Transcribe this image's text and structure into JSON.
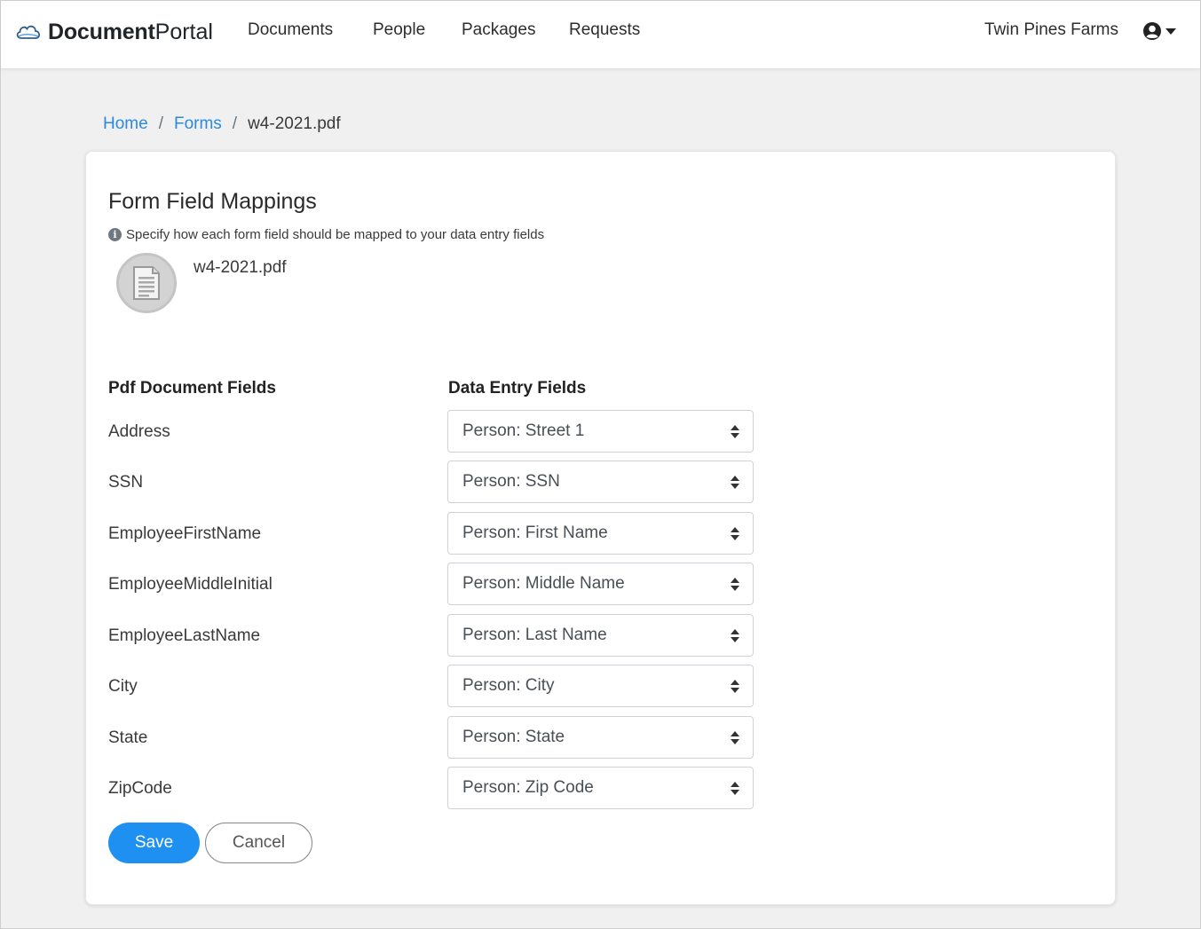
{
  "header": {
    "brand_bold": "Document",
    "brand_light": "Portal",
    "nav": [
      "Documents",
      "People",
      "Packages",
      "Requests"
    ],
    "organization": "Twin Pines Farms",
    "icons": {
      "brand": "cloud-icon",
      "user": "user-circle-icon"
    }
  },
  "breadcrumb": {
    "home": "Home",
    "forms": "Forms",
    "current": "w4-2021.pdf"
  },
  "card": {
    "title": "Form Field Mappings",
    "hint": "Specify how each form field should be mapped to your data entry fields",
    "file_name": "w4-2021.pdf",
    "col_pdf": "Pdf Document Fields",
    "col_data": "Data Entry Fields",
    "rows": [
      {
        "label": "Address",
        "value": "Person: Street 1"
      },
      {
        "label": "SSN",
        "value": "Person: SSN"
      },
      {
        "label": "EmployeeFirstName",
        "value": "Person: First Name"
      },
      {
        "label": "EmployeeMiddleInitial",
        "value": "Person: Middle Name"
      },
      {
        "label": "EmployeeLastName",
        "value": "Person: Last Name"
      },
      {
        "label": "City",
        "value": "Person: City"
      },
      {
        "label": "State",
        "value": "Person: State"
      },
      {
        "label": "ZipCode",
        "value": "Person: Zip Code"
      }
    ],
    "save_label": "Save",
    "cancel_label": "Cancel"
  },
  "colors": {
    "accent": "#1e90f2",
    "link": "#2a8ae0",
    "background": "#f0f0f0"
  }
}
